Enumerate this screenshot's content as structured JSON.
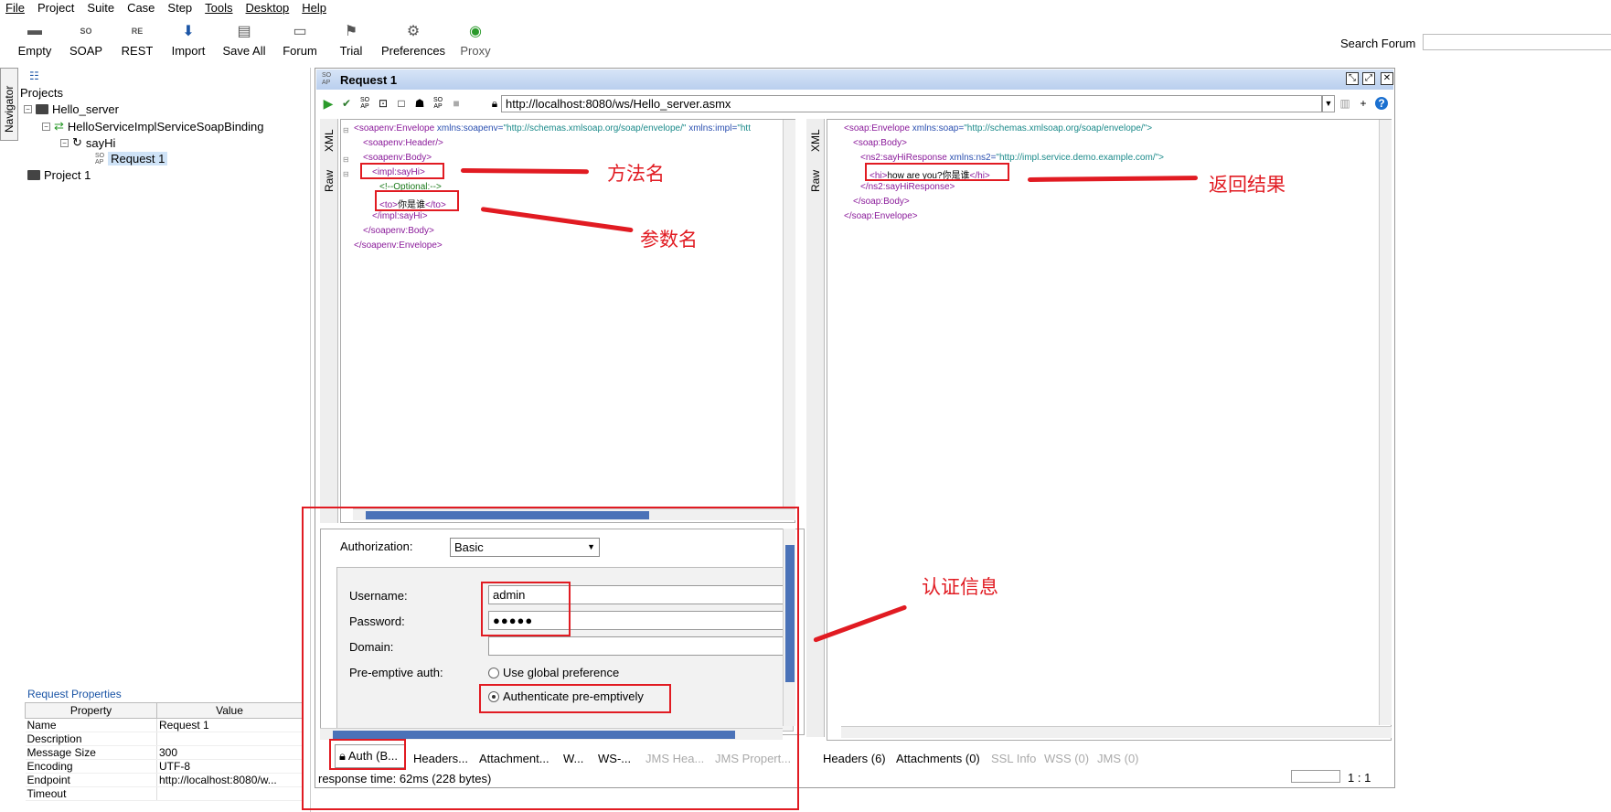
{
  "menu": [
    "File",
    "Project",
    "Suite",
    "Case",
    "Step",
    "Tools",
    "Desktop",
    "Help"
  ],
  "toolbar": {
    "buttons": [
      {
        "label": "Empty",
        "icon": "folder-icon"
      },
      {
        "label": "SOAP",
        "icon": "soap-icon"
      },
      {
        "label": "REST",
        "icon": "rest-icon"
      },
      {
        "label": "Import",
        "icon": "import-icon"
      },
      {
        "label": "Save All",
        "icon": "save-all-icon"
      },
      {
        "label": "Forum",
        "icon": "forum-icon"
      },
      {
        "label": "Trial",
        "icon": "trial-icon"
      },
      {
        "label": "Preferences",
        "icon": "gear-icon"
      },
      {
        "label": "Proxy",
        "icon": "proxy-icon"
      }
    ],
    "search_label": "Search Forum"
  },
  "navigator": {
    "tab_label": "Navigator",
    "projects_label": "Projects",
    "tree": {
      "project": "Hello_server",
      "binding": "HelloServiceImplServiceSoapBinding",
      "operation": "sayHi",
      "request": "Request 1",
      "project2": "Project 1"
    }
  },
  "request_properties": {
    "title": "Request Properties",
    "headers": [
      "Property",
      "Value"
    ],
    "rows": [
      {
        "property": "Name",
        "value": "Request 1"
      },
      {
        "property": "Description",
        "value": ""
      },
      {
        "property": "Message Size",
        "value": "300"
      },
      {
        "property": "Encoding",
        "value": "UTF-8"
      },
      {
        "property": "Endpoint",
        "value": "http://localhost:8080/w..."
      },
      {
        "property": "Timeout",
        "value": ""
      }
    ]
  },
  "request_window": {
    "title": "Request 1",
    "endpoint_url": "http://localhost:8080/ws/Hello_server.asmx"
  },
  "editor_tabs": {
    "xml": "XML",
    "raw": "Raw"
  },
  "request_xml": {
    "l1_tag": "<soapenv:Envelope",
    "l1_attr1": " xmlns:soapenv=",
    "l1_val1": "\"http://schemas.xmlsoap.org/soap/envelope/\"",
    "l1_attr2": " xmlns:impl=",
    "l1_val2": "\"htt",
    "l2": "<soapenv:Header/>",
    "l3": "<soapenv:Body>",
    "l4": "<impl:sayHi>",
    "l5": "<!--Optional:-->",
    "l6_open": "<to>",
    "l6_text": "你是谁",
    "l6_close": "</to>",
    "l7": "</impl:sayHi>",
    "l8": "</soapenv:Body>",
    "l9": "</soapenv:Envelope>"
  },
  "response_xml": {
    "l1_tag": "<soap:Envelope",
    "l1_attr": " xmlns:soap=",
    "l1_val": "\"http://schemas.xmlsoap.org/soap/envelope/\">",
    "l2": "<soap:Body>",
    "l3_tag": "<ns2:sayHiResponse",
    "l3_attr": " xmlns:ns2=",
    "l3_val": "\"http://impl.service.demo.example.com/\">",
    "l4_open": "<hi>",
    "l4_text": "how are you?你是谁",
    "l4_close": "</hi>",
    "l5": "</ns2:sayHiResponse>",
    "l6": "</soap:Body>",
    "l7": "</soap:Envelope>"
  },
  "auth": {
    "authorization_label": "Authorization:",
    "authorization_value": "Basic",
    "username_label": "Username:",
    "username_value": "admin",
    "password_label": "Password:",
    "password_value": "●●●●●",
    "domain_label": "Domain:",
    "domain_value": "",
    "preemptive_label": "Pre-emptive auth:",
    "option_global": "Use global preference",
    "option_preemptive": "Authenticate pre-emptively",
    "selected_option": "Authenticate pre-emptively"
  },
  "request_tabs": [
    "Auth (B...",
    "Headers...",
    "Attachment...",
    "W...",
    "WS-...",
    "JMS Hea...",
    "JMS Propert..."
  ],
  "response_tabs": [
    "Headers (6)",
    "Attachments (0)",
    "SSL Info",
    "WSS (0)",
    "JMS (0)"
  ],
  "status": {
    "response_time": "response time: 62ms (228 bytes)",
    "cursor": "1 : 1"
  },
  "annotations": {
    "method_name": "方法名",
    "param_name": "参数名",
    "return_result": "返回结果",
    "auth_info": "认证信息"
  },
  "colors": {
    "annotation": "#e11b22",
    "accent": "#1b55a6"
  }
}
